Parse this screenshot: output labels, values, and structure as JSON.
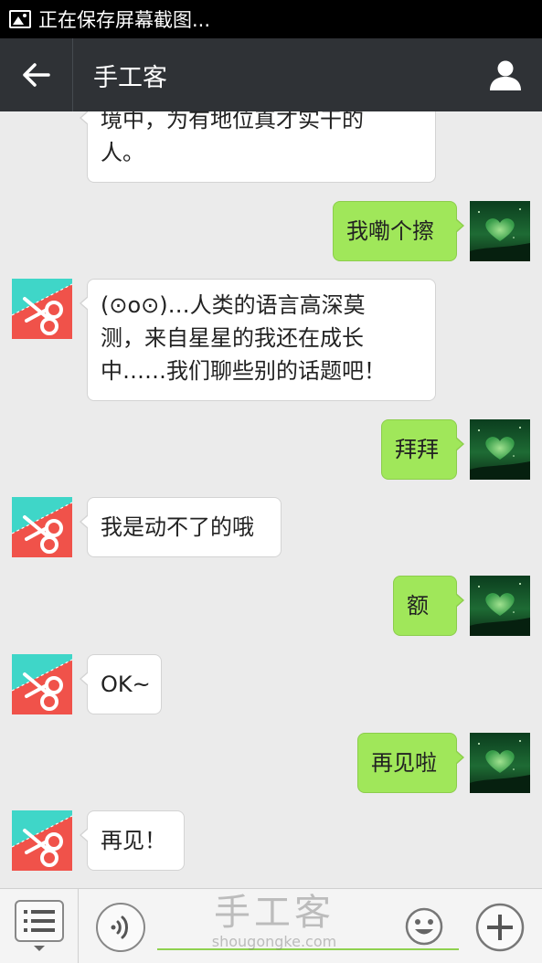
{
  "status_bar": {
    "text": "正在保存屏幕截图..."
  },
  "title_bar": {
    "title": "手工客"
  },
  "chat": {
    "messages": [
      {
        "side": "left",
        "lines": [
          "境中，为有地位真才实干的",
          "人。"
        ]
      },
      {
        "side": "right",
        "text": "我嘞个擦"
      },
      {
        "side": "left",
        "lines": [
          "(⊙o⊙)…人类的语言高深莫",
          "测，来自星星的我还在成长",
          "中……我们聊些别的话题吧！"
        ]
      },
      {
        "side": "right",
        "text": "拜拜"
      },
      {
        "side": "left",
        "text": "我是动不了的哦"
      },
      {
        "side": "right",
        "text": "额"
      },
      {
        "side": "left",
        "text": "OK~"
      },
      {
        "side": "right",
        "text": "再见啦"
      },
      {
        "side": "left",
        "text": "再见！"
      }
    ]
  },
  "watermark": {
    "cn": "手工客",
    "en": "shougongke.com"
  },
  "colors": {
    "title_bar": "#2f3236",
    "bubble_right": "#a0e75a",
    "bot_avatar_red": "#f0524a",
    "bot_avatar_teal": "#3fd6c8",
    "input_line": "#8fd14f"
  }
}
